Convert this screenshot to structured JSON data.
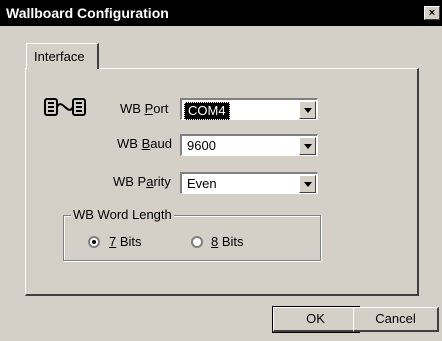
{
  "window": {
    "title": "Wallboard Configuration",
    "close_label": "×"
  },
  "tabs": [
    {
      "label": "Interface"
    }
  ],
  "fields": {
    "port": {
      "prefix": "WB ",
      "key": "P",
      "suffix": "ort",
      "value": "COM4"
    },
    "baud": {
      "prefix": "WB ",
      "key": "B",
      "suffix": "aud",
      "value": "9600"
    },
    "parity": {
      "prefix": "WB P",
      "key": "a",
      "suffix": "rity",
      "value": "Even"
    }
  },
  "word_length": {
    "legend": "WB Word Length",
    "options": [
      {
        "key": "7",
        "rest": " Bits",
        "selected": true
      },
      {
        "key": "8",
        "rest": " Bits",
        "selected": false
      }
    ]
  },
  "buttons": {
    "ok": "OK",
    "cancel": "Cancel"
  },
  "icons": {
    "port": "serial-port-icon"
  }
}
